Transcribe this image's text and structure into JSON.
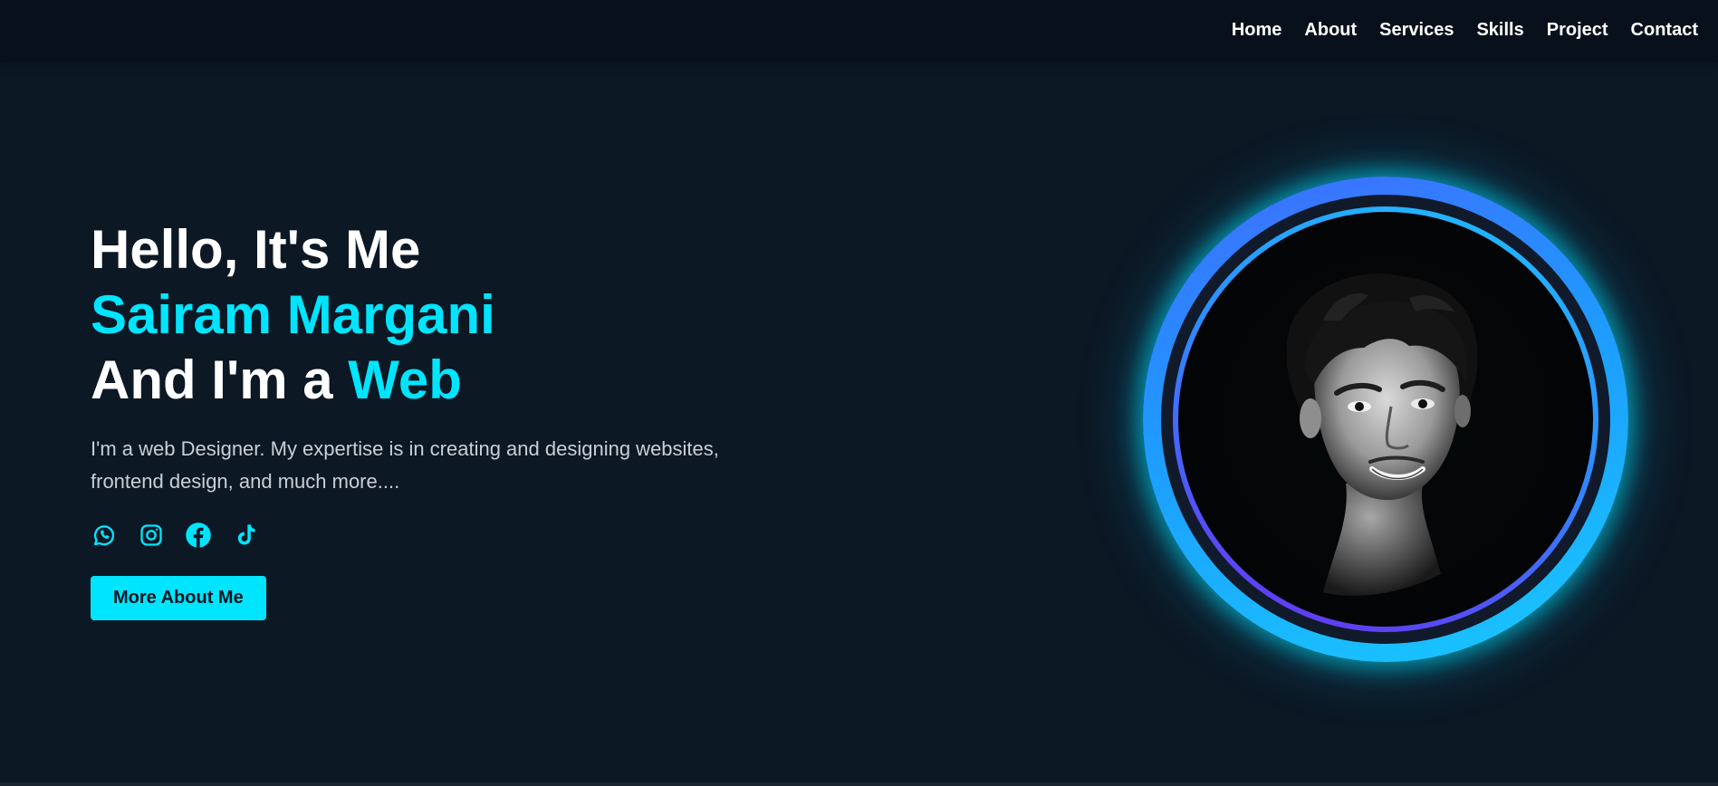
{
  "nav": {
    "items": [
      {
        "label": "Home"
      },
      {
        "label": "About"
      },
      {
        "label": "Services"
      },
      {
        "label": "Skills"
      },
      {
        "label": "Project"
      },
      {
        "label": "Contact"
      }
    ]
  },
  "hero": {
    "greeting": "Hello, It's Me",
    "name": "Sairam Margani",
    "role_prefix": "And I'm a ",
    "role": "Web",
    "description": "I'm a web Designer. My expertise is in creating and designing websites, frontend design, and much more....",
    "cta_label": "More About Me"
  },
  "socials": [
    {
      "icon": "whatsapp-icon"
    },
    {
      "icon": "instagram-icon"
    },
    {
      "icon": "facebook-icon"
    },
    {
      "icon": "tiktok-icon"
    }
  ],
  "colors": {
    "background": "#0c1824",
    "navbar": "#08111b",
    "accent": "#00e5ff",
    "ring_blue": "#2e8cff",
    "ring_purple": "#6a2cf0"
  }
}
